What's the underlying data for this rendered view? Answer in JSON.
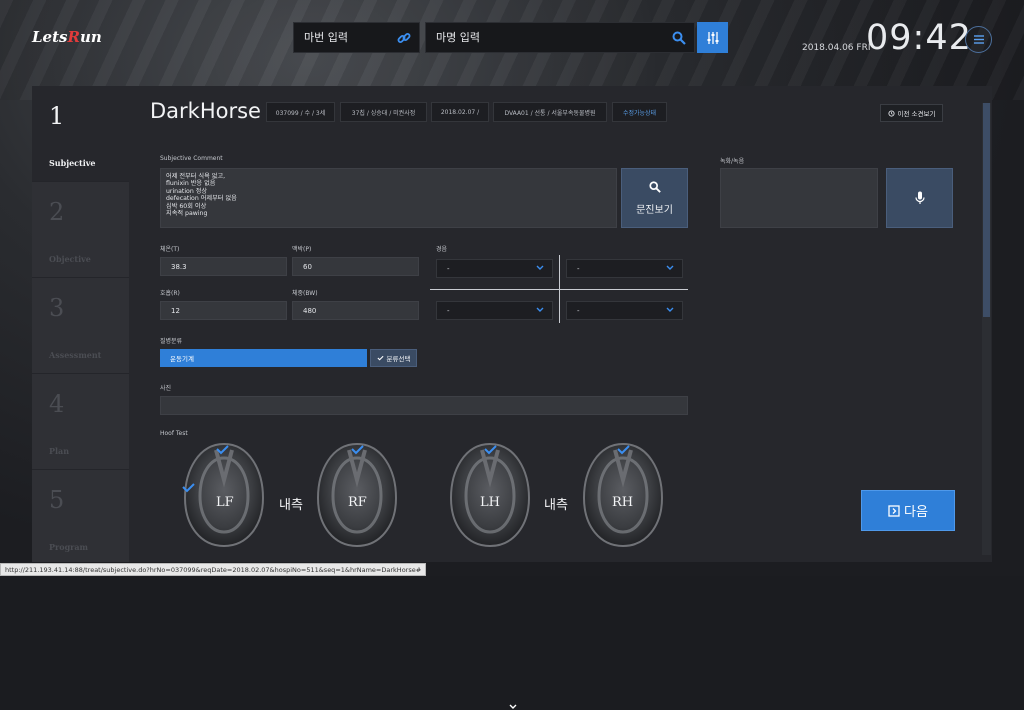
{
  "header": {
    "logo_pre": "Lets",
    "logo_r": "R",
    "logo_post": "un",
    "horse_no_placeholder": "마번 입력",
    "horse_name_placeholder": "마명 입력",
    "date": "2018.04.06 FRI",
    "clock": "09:42"
  },
  "steps": [
    {
      "num": "1",
      "label": "Subjective"
    },
    {
      "num": "2",
      "label": "Objective"
    },
    {
      "num": "3",
      "label": "Assessment"
    },
    {
      "num": "4",
      "label": "Plan"
    },
    {
      "num": "5",
      "label": "Program"
    }
  ],
  "horse": {
    "name": "DarkHorse",
    "chips": [
      "037099 / 수 / 3세",
      "37칩 / 싱승대 / 미권사정",
      "2018.02.07 /",
      "DVAA01 / 선통 / 서울부속동물병원",
      "수정가능상태"
    ],
    "prev_button": "이전 소견보기"
  },
  "subjective": {
    "comment_label": "Subjective Comment",
    "comment_text": "어제 전부터 식욕 없고,\nflunixin 반응 없음\nurination 정상\ndefecation 어제부터 없음\n심박 60회 이상\n지속적 pawing",
    "inquiry_button": "문진보기",
    "record_label": "녹화/녹음"
  },
  "vitals": {
    "temp_label": "체온(T)",
    "temp_value": "38.3",
    "pulse_label": "맥박(P)",
    "pulse_value": "60",
    "resp_label": "호흡(R)",
    "resp_value": "12",
    "weight_label": "체중(BW)",
    "weight_value": "480",
    "pain_label": "경음",
    "selects": [
      "-",
      "-",
      "-",
      "-"
    ]
  },
  "category": {
    "label": "질병분류",
    "selected": "운동기계",
    "button": "분류선택"
  },
  "photo_label": "사진",
  "hoof": {
    "label": "Hoof Test",
    "hooves": [
      "LF",
      "RF",
      "LH",
      "RH"
    ],
    "inner_label": "내측"
  },
  "next_button": "다음",
  "status_url": "http://211.193.41.14:88/treat/subjective.do?hrNo=037099&reqDate=2018.02.07&hospiNo=511&seq=1&hrName=DarkHorse#",
  "colors": {
    "accent": "#2f7fd8",
    "panel": "#26272c",
    "button_dark_blue": "#3a4b63"
  }
}
